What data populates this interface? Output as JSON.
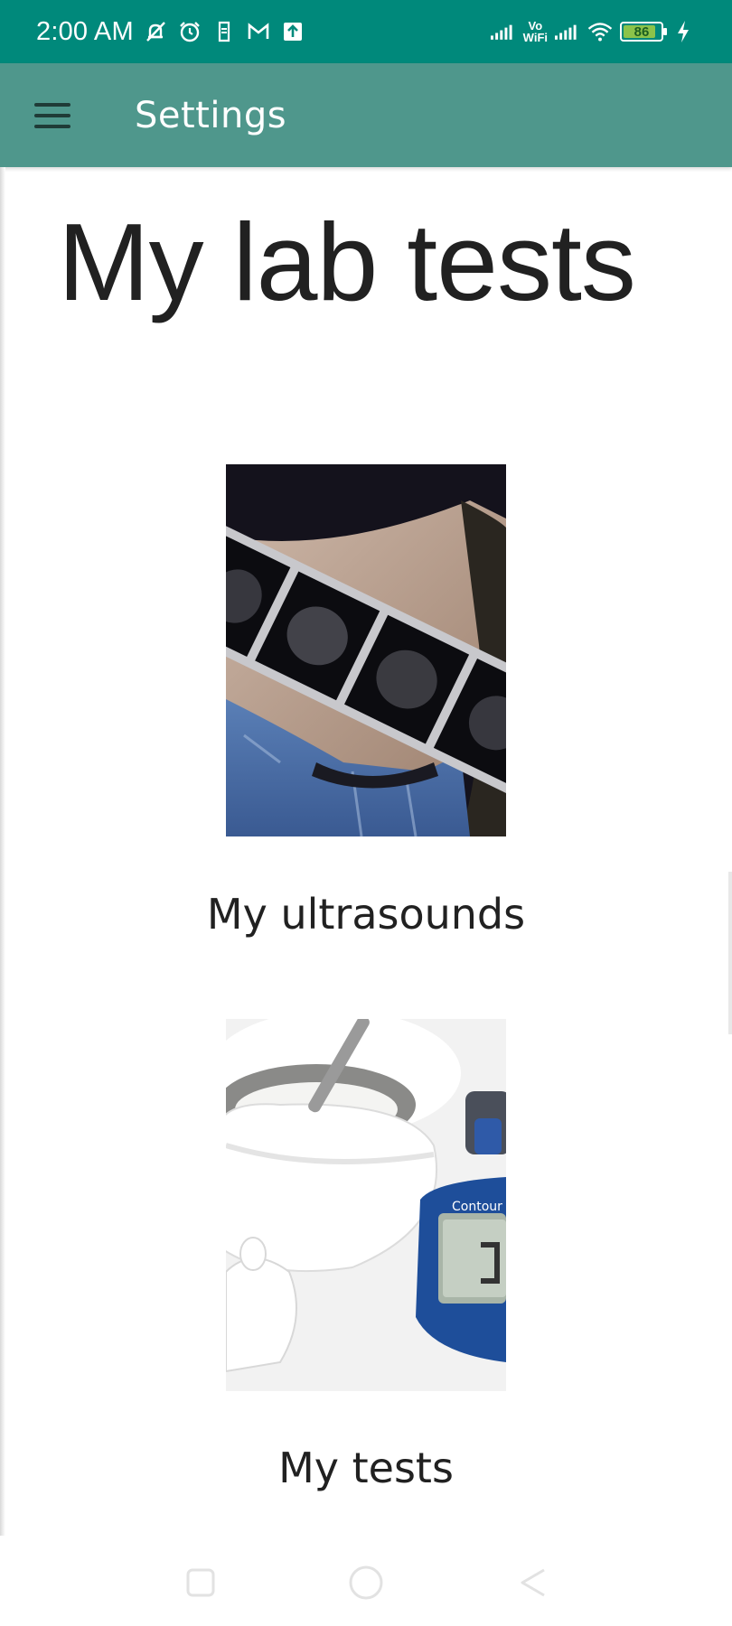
{
  "status_bar": {
    "time": "2:00 AM",
    "icons": [
      "muted-bell-icon",
      "alarm-icon",
      "sim-icon",
      "gmail-icon",
      "upload-icon",
      "signal-icon",
      "vowifi-icon",
      "wifi-icon",
      "battery-icon",
      "charging-icon"
    ],
    "vowifi_top": "Vo",
    "vowifi_bottom": "WiFi",
    "battery": "86"
  },
  "app_bar": {
    "title": "Settings",
    "menu_icon": "hamburger-menu-icon",
    "color": "#4f978c"
  },
  "main": {
    "page_title": "My lab tests",
    "cards": [
      {
        "label": "My ultrasounds",
        "image": "ultrasound-photo"
      },
      {
        "label": "My tests",
        "image": "glucose-meter-photo"
      }
    ]
  },
  "nav_bar": {
    "icons": [
      "recents-square-icon",
      "home-circle-icon",
      "back-triangle-icon"
    ]
  },
  "colors": {
    "status_bar": "#00897b",
    "app_bar": "#4f978c",
    "text": "#212121"
  }
}
